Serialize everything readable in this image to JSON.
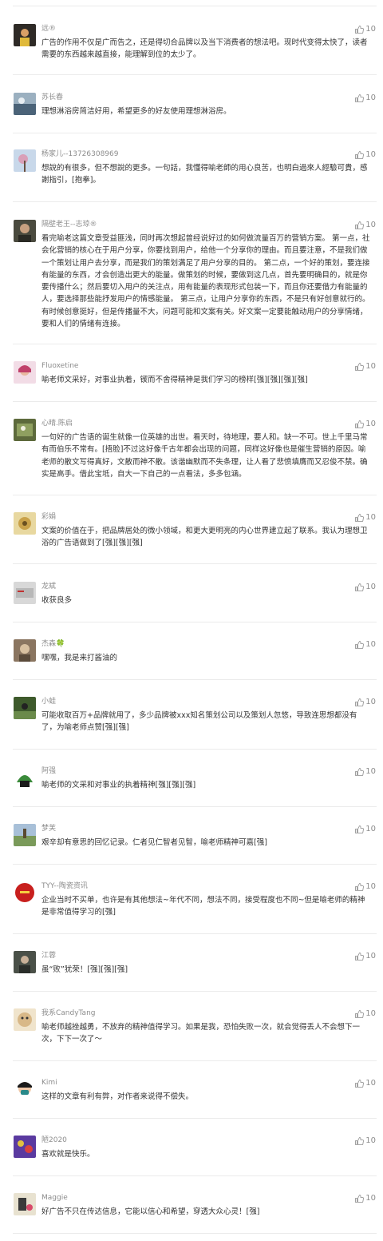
{
  "comments": [
    {
      "nickname": "远®",
      "content": "广告的作用不仅是广而告之，还是得切合品牌以及当下消费者的想法吧。现时代变得太快了，读者需要的东西越来越直接，能理解到位的太少了。",
      "likes": "10",
      "avatar_color": "#2e2a26"
    },
    {
      "nickname": "苏长春",
      "content": "理想淋浴房简洁好用，希望更多的好友使用理想淋浴房。",
      "likes": "10",
      "avatar_color": "#6f8aa0"
    },
    {
      "nickname": "杨家儿--13726308969",
      "content": "想說的有很多，但不想說的更多。一句話，我懂得喻老師的用心良苦，也明白過來人經驗可貴，感謝指引，[抱拳]。",
      "likes": "10",
      "avatar_color": "#a9c2dc"
    },
    {
      "nickname": "隔壁老王--志琼®",
      "content": "看完喻老这篇文章受益匪浅，同时再次想起曾经说好过的如何做流量百万的营销方案。 第一点，社会化营销的核心在于用户分享，你要找到用户，给他一个分享你的理由。而且要注意，不是我们做一个策划让用户去分享，而是我们的策划满足了用户分享的目的。 第二点，一个好的策划，要连接有能量的东西，才会创造出更大的能量。做策划的时候，要做到这几点，首先要明确目的，就是你要传播什么；然后要切入用户的关注点，用有能量的表现形式包装一下，而且你还要借力有能量的人，要选择那些能抒发用户的情感能量。 第三点，让用户分享你的东西，不是只有好创意就行的。有时候创意挺好，但是传播量不大，问题可能和文案有关。好文案一定要能触动用户的分享情绪，要和人们的情绪有连接。",
      "likes": "10",
      "avatar_color": "#4a4a3e"
    },
    {
      "nickname": "Fluoxetine",
      "content": "喻老师文采好，对事业执着，锲而不舍得精神是我们学习的榜样[强][强][强][强]",
      "likes": "10",
      "avatar_color": "#d08aa8"
    },
    {
      "nickname": "心晴.陈启",
      "content": "一句好的广告语的诞生就像一位英雄的出世。看天时，待地理，要人和。缺一不可。世上千里马常有而伯乐不常有。[捂脸]不过这好像千古年都会出现的问题，同样这好像也是催生营销的原因。喻老师的散文写得真好，文散而神不散。该谐幽默而不失条理，让人看了悲愤填膺而又忍俊不禁。确实是高手。借此宝坻，自大一下自己的一点看法，多多包涵。",
      "likes": "10",
      "avatar_color": "#5d6a3c"
    },
    {
      "nickname": "彩娟",
      "content": "文案的价值在于，把品牌居处的微小领域，和更大更明亮的内心世界建立起了联系。我认为理想卫浴的广告语做到了[强][强][强]",
      "likes": "10",
      "avatar_color": "#c9a24a"
    },
    {
      "nickname": "龙斌",
      "content": "收获良多",
      "likes": "10",
      "avatar_color": "#b8b8b8"
    },
    {
      "nickname": "杰森🍀",
      "content": "嘿嘿，我是来打酱油的",
      "likes": "10",
      "avatar_color": "#8a7560"
    },
    {
      "nickname": "小蛙",
      "content": "可能收取百万+品牌就用了，多少品牌被xxx知名策划公司以及策划人忽悠，导致连思想都没有了，为喻老师点赞[强][强]",
      "likes": "10",
      "avatar_color": "#3e5a2c"
    },
    {
      "nickname": "阿强",
      "content": "喻老师的文采和对事业的执着精神[强][强][强]",
      "likes": "10",
      "avatar_color": "#3a8a3a"
    },
    {
      "nickname": "梦芙",
      "content": "艰辛却有意思的回忆记录。仁者见仁智者见智，喻老师精神可嘉[强]",
      "likes": "10",
      "avatar_color": "#7a9a5a"
    },
    {
      "nickname": "TYY--陶瓷资讯",
      "content": "企业当时不买单，也许是有其他想法~年代不同，想法不同，接受程度也不同~但是喻老师的精神是非常值得学习的[强]",
      "likes": "10",
      "avatar_color": "#c8201e"
    },
    {
      "nickname": "江蓉",
      "content": "虽“败”犹荣！[强][强][强]",
      "likes": "10",
      "avatar_color": "#4a5048"
    },
    {
      "nickname": "我系CandyTang",
      "content": "喻老师越挫越勇，不放弃的精神值得学习。如果是我，恐怕失败一次，就会觉得丢人不会想下一次，下下一次了～",
      "likes": "10",
      "avatar_color": "#d8b888"
    },
    {
      "nickname": "Kimi",
      "content": "这样的文章有利有弊，对作者来说得不偿失。",
      "likes": "10",
      "avatar_color": "#2a8a8a"
    },
    {
      "nickname": "陋2020",
      "content": "喜欢就是快乐。",
      "likes": "10",
      "avatar_color": "#5a3aa0"
    },
    {
      "nickname": "Maggie",
      "content": "好广告不只在传达信息，它能以信心和希望，穿透大众心灵！[强]",
      "likes": "10",
      "avatar_color": "#e8e2d0"
    }
  ]
}
